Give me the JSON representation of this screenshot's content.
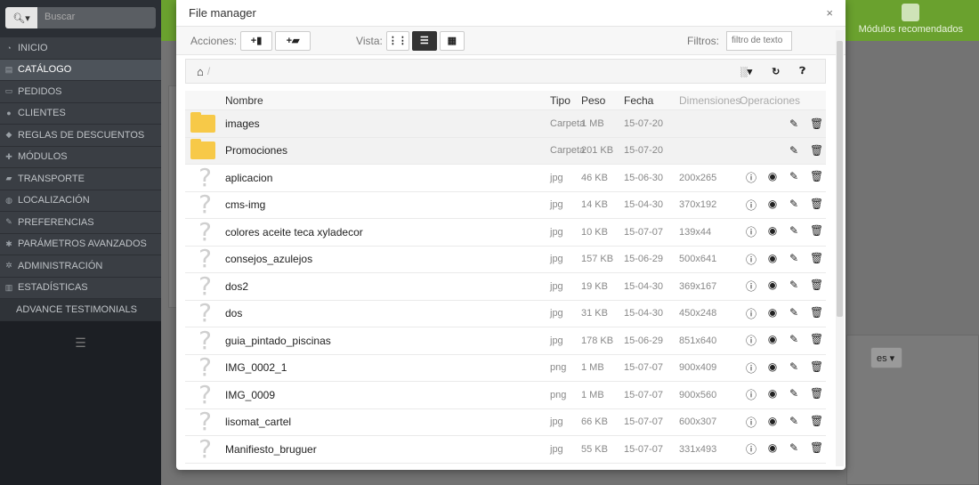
{
  "sidebar": {
    "search_placeholder": "Buscar",
    "items": [
      {
        "label": "INICIO",
        "icon": "dashboard-icon"
      },
      {
        "label": "CATÁLOGO",
        "icon": "book-icon",
        "active": true
      },
      {
        "label": "PEDIDOS",
        "icon": "credit-card-icon"
      },
      {
        "label": "CLIENTES",
        "icon": "users-icon"
      },
      {
        "label": "REGLAS DE DESCUENTOS",
        "icon": "tag-icon"
      },
      {
        "label": "MÓDULOS",
        "icon": "puzzle-icon"
      },
      {
        "label": "TRANSPORTE",
        "icon": "truck-icon"
      },
      {
        "label": "LOCALIZACIÓN",
        "icon": "globe-icon"
      },
      {
        "label": "PREFERENCIAS",
        "icon": "wrench-icon"
      },
      {
        "label": "PARÁMETROS AVANZADOS",
        "icon": "cogs-icon"
      },
      {
        "label": "ADMINISTRACIÓN",
        "icon": "gear-icon"
      },
      {
        "label": "ESTADÍSTICAS",
        "icon": "chart-icon"
      },
      {
        "label": "ADVANCE TESTIMONIALS",
        "icon": ""
      }
    ]
  },
  "topbar": {
    "modules_label": "Módulos recomendados",
    "truncated": "A"
  },
  "language_button": "es",
  "modal": {
    "title": "File manager",
    "close": "×",
    "toolbar": {
      "actions_label": "Acciones:",
      "view_label": "Vista:",
      "filters_label": "Filtros:",
      "filter_placeholder": "filtro de texto"
    },
    "columns": {
      "name": "Nombre",
      "type": "Tipo",
      "size": "Peso",
      "date": "Fecha",
      "dimensions": "Dimensiones",
      "operations": "Operaciones"
    },
    "files": [
      {
        "name": "images",
        "type": "Carpeta",
        "size": "1 MB",
        "date": "15-07-20",
        "dim": "",
        "folder": true
      },
      {
        "name": "Promociones",
        "type": "Carpeta",
        "size": "201 KB",
        "date": "15-07-20",
        "dim": "",
        "folder": true
      },
      {
        "name": "aplicacion",
        "type": "jpg",
        "size": "46 KB",
        "date": "15-06-30",
        "dim": "200x265"
      },
      {
        "name": "cms-img",
        "type": "jpg",
        "size": "14 KB",
        "date": "15-04-30",
        "dim": "370x192"
      },
      {
        "name": "colores aceite teca xyladecor",
        "type": "jpg",
        "size": "10 KB",
        "date": "15-07-07",
        "dim": "139x44"
      },
      {
        "name": "consejos_azulejos",
        "type": "jpg",
        "size": "157 KB",
        "date": "15-06-29",
        "dim": "500x641"
      },
      {
        "name": "dos2",
        "type": "jpg",
        "size": "19 KB",
        "date": "15-04-30",
        "dim": "369x167"
      },
      {
        "name": "dos",
        "type": "jpg",
        "size": "31 KB",
        "date": "15-04-30",
        "dim": "450x248"
      },
      {
        "name": "guia_pintado_piscinas",
        "type": "jpg",
        "size": "178 KB",
        "date": "15-06-29",
        "dim": "851x640"
      },
      {
        "name": "IMG_0002_1",
        "type": "png",
        "size": "1 MB",
        "date": "15-07-07",
        "dim": "900x409"
      },
      {
        "name": "IMG_0009",
        "type": "png",
        "size": "1 MB",
        "date": "15-07-07",
        "dim": "900x560"
      },
      {
        "name": "lisomat_cartel",
        "type": "jpg",
        "size": "66 KB",
        "date": "15-07-07",
        "dim": "600x307"
      },
      {
        "name": "Manifiesto_bruguer",
        "type": "jpg",
        "size": "55 KB",
        "date": "15-07-07",
        "dim": "331x493"
      }
    ]
  }
}
